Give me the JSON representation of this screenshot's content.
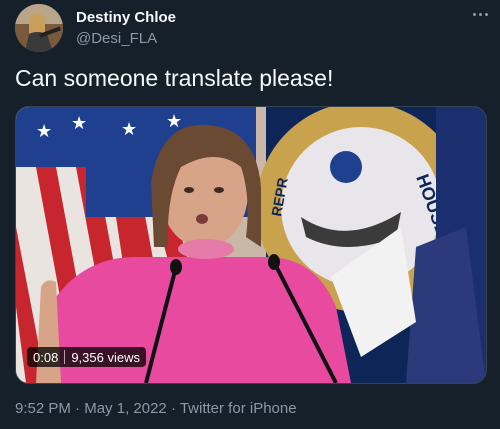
{
  "user": {
    "display_name": "Destiny Chloe",
    "handle": "@Desi_FLA"
  },
  "tweet": {
    "text": "Can someone translate please!"
  },
  "media": {
    "duration": "0:08",
    "views": "9,356 views"
  },
  "meta": {
    "time": "9:52 PM",
    "separator": " · ",
    "date": "May 1, 2022",
    "source": "Twitter for iPhone"
  },
  "icons": {
    "more": "more-horizontal-icon"
  },
  "colors": {
    "background": "#15202b",
    "primary_text": "#f7f9f9",
    "secondary_text": "#8b98a5"
  }
}
